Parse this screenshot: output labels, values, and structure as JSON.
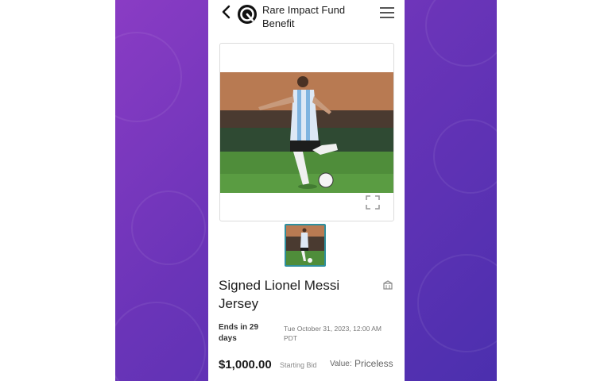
{
  "header": {
    "org_name": "Rare Impact Fund Benefit",
    "back_icon": "chevron-left-icon",
    "logo_icon": "rare-impact-logo-icon",
    "menu_icon": "hamburger-menu-icon"
  },
  "item": {
    "title": "Signed Lionel Messi Jersey",
    "ends_in": "Ends in 29 days",
    "end_date": "Tue October 31, 2023, 12:00 AM PDT",
    "starting_bid": "$1,000.00",
    "starting_bid_label": "Starting Bid",
    "value_label": "Value:",
    "value": "Priceless",
    "share_icon": "share-icon",
    "expand_icon": "expand-icon"
  },
  "colors": {
    "background_gradient_start": "#8a3cc4",
    "background_gradient_end": "#4b2fae",
    "thumbnail_border": "#2f8f9e"
  }
}
